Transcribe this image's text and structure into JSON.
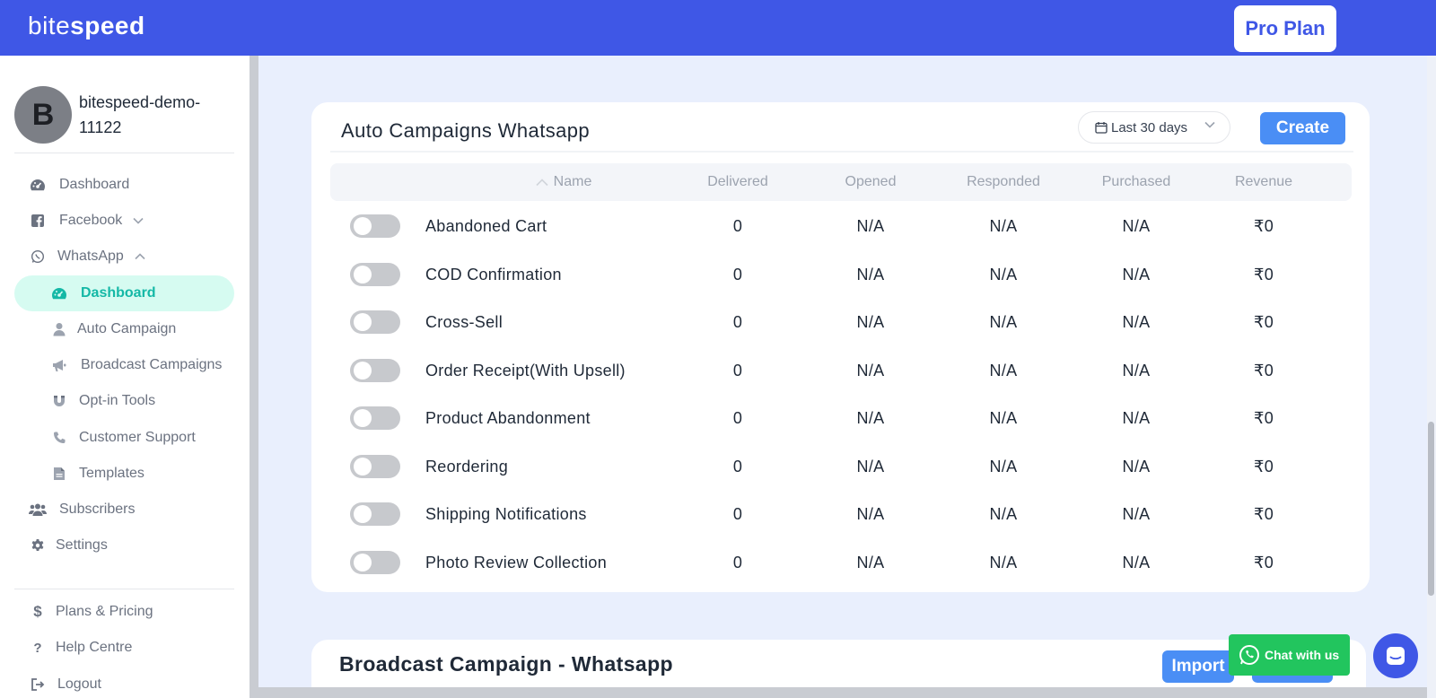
{
  "header": {
    "logo_light": "bite",
    "logo_bold": "speed",
    "pro_plan_label": "Pro Plan"
  },
  "profile": {
    "avatar_letter": "B",
    "name": "bitespeed-demo-11122"
  },
  "sidebar": {
    "items": [
      {
        "label": "Dashboard",
        "icon": "dashboard-icon"
      },
      {
        "label": "Facebook",
        "icon": "facebook-icon"
      },
      {
        "label": "WhatsApp",
        "icon": "whatsapp-icon"
      },
      {
        "label": "Dashboard",
        "icon": "dashboard-icon"
      },
      {
        "label": "Auto Campaign",
        "icon": "user-icon"
      },
      {
        "label": "Broadcast Campaigns",
        "icon": "megaphone-icon"
      },
      {
        "label": "Opt-in Tools",
        "icon": "magnet-icon"
      },
      {
        "label": "Customer Support",
        "icon": "phone-icon"
      },
      {
        "label": "Templates",
        "icon": "document-icon"
      },
      {
        "label": "Subscribers",
        "icon": "users-icon"
      },
      {
        "label": "Settings",
        "icon": "gear-icon"
      },
      {
        "label": "Plans & Pricing",
        "icon": "dollar-icon"
      },
      {
        "label": "Help Centre",
        "icon": "question-icon"
      },
      {
        "label": "Logout",
        "icon": "logout-icon"
      }
    ]
  },
  "auto_campaigns": {
    "title": "Auto Campaigns Whatsapp",
    "date_range": "Last 30 days",
    "create_label": "Create",
    "columns": [
      "Name",
      "Delivered",
      "Opened",
      "Responded",
      "Purchased",
      "Revenue"
    ],
    "rows": [
      {
        "name": "Abandoned Cart",
        "delivered": "0",
        "opened": "N/A",
        "responded": "N/A",
        "purchased": "N/A",
        "revenue": "₹0",
        "enabled": false
      },
      {
        "name": "COD Confirmation",
        "delivered": "0",
        "opened": "N/A",
        "responded": "N/A",
        "purchased": "N/A",
        "revenue": "₹0",
        "enabled": false
      },
      {
        "name": "Cross-Sell",
        "delivered": "0",
        "opened": "N/A",
        "responded": "N/A",
        "purchased": "N/A",
        "revenue": "₹0",
        "enabled": false
      },
      {
        "name": "Order Receipt(With Upsell)",
        "delivered": "0",
        "opened": "N/A",
        "responded": "N/A",
        "purchased": "N/A",
        "revenue": "₹0",
        "enabled": false
      },
      {
        "name": "Product Abandonment",
        "delivered": "0",
        "opened": "N/A",
        "responded": "N/A",
        "purchased": "N/A",
        "revenue": "₹0",
        "enabled": false
      },
      {
        "name": "Reordering",
        "delivered": "0",
        "opened": "N/A",
        "responded": "N/A",
        "purchased": "N/A",
        "revenue": "₹0",
        "enabled": false
      },
      {
        "name": "Shipping Notifications",
        "delivered": "0",
        "opened": "N/A",
        "responded": "N/A",
        "purchased": "N/A",
        "revenue": "₹0",
        "enabled": false
      },
      {
        "name": "Photo Review Collection",
        "delivered": "0",
        "opened": "N/A",
        "responded": "N/A",
        "purchased": "N/A",
        "revenue": "₹0",
        "enabled": false
      }
    ]
  },
  "broadcast": {
    "title": "Broadcast Campaign - Whatsapp",
    "import_label": "Import"
  },
  "chat": {
    "whatsapp_label": "Chat with us"
  },
  "colors": {
    "brand": "#3f57e6",
    "accent_button": "#4a8ef5",
    "active_nav_bg": "#d6fbf1",
    "active_nav_text": "#14b8a6",
    "whatsapp_green": "#22c55e"
  }
}
